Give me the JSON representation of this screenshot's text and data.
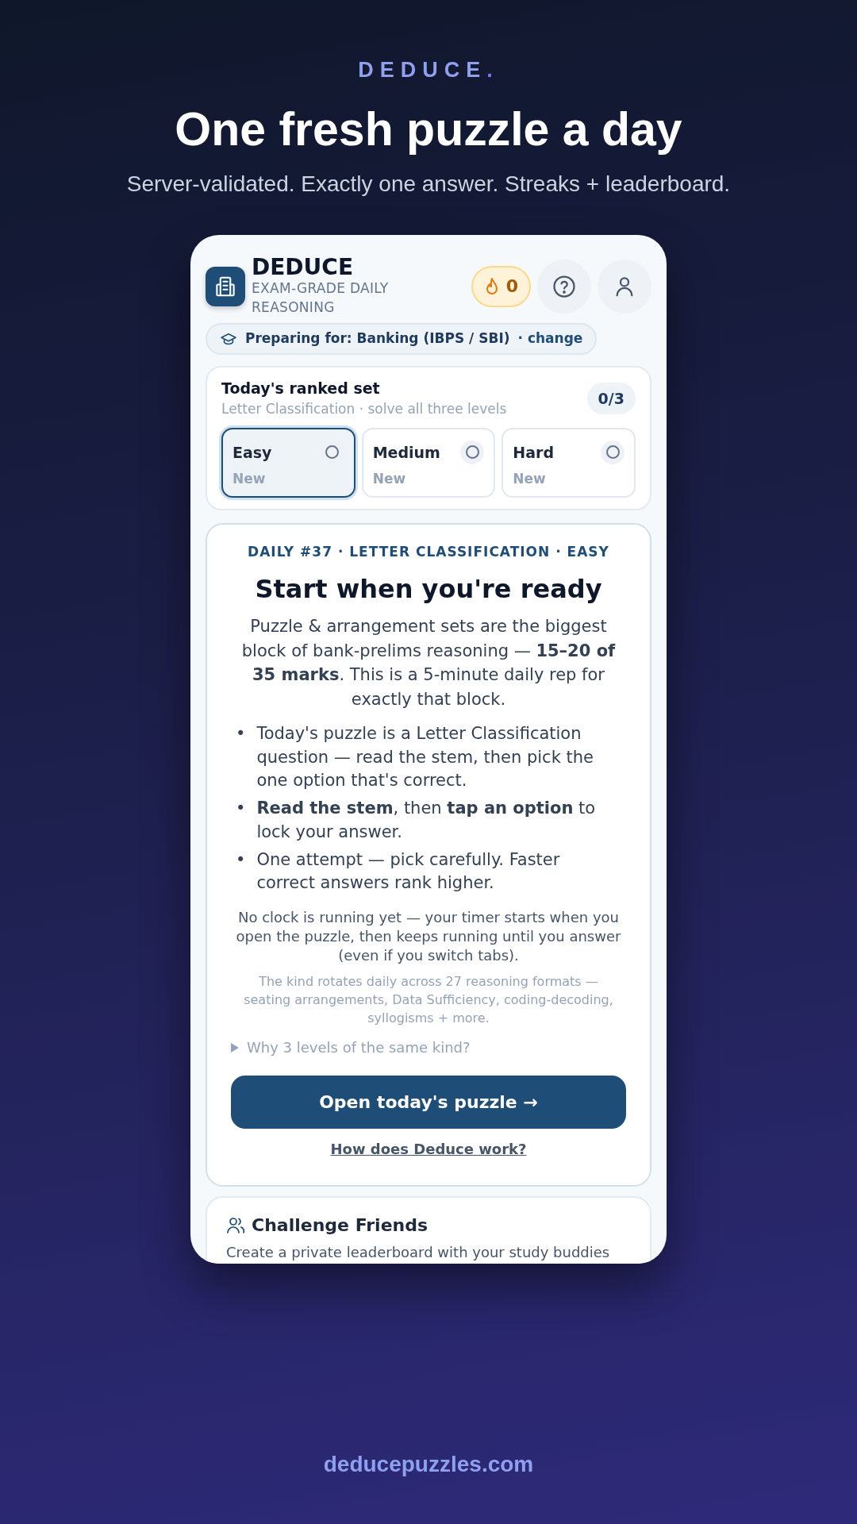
{
  "hero": {
    "brand_name": "DEDUCE",
    "brand_dot": ".",
    "headline": "One fresh puzzle a day",
    "subtitle": "Server-validated. Exactly one answer. Streaks + leaderboard."
  },
  "app": {
    "title": "DEDUCE",
    "tagline": "EXAM-GRADE DAILY REASONING",
    "streak": "0",
    "preparing": {
      "label": "Preparing for: Banking (IBPS / SBI)",
      "link": "· change"
    },
    "ranked_set": {
      "title": "Today's ranked set",
      "subtitle": "Letter Classification · solve all three levels",
      "progress": "0/3",
      "levels": [
        {
          "label": "Easy",
          "status": "New",
          "selected": true,
          "done": false
        },
        {
          "label": "Medium",
          "status": "New",
          "selected": false,
          "done": false
        },
        {
          "label": "Hard",
          "status": "New",
          "selected": false,
          "done": false
        }
      ]
    },
    "daily": {
      "eyebrow": "DAILY #37 · LETTER CLASSIFICATION · EASY",
      "title": "Start when you're ready",
      "intro": "Puzzle & arrangement sets are the biggest block of bank-prelims reasoning — **15–20 of 35 marks**. This is a 5-minute daily rep for exactly that block.",
      "bullets": [
        {
          "marker": "•",
          "text": "Today's puzzle is a Letter Classification question — read the stem, then pick the one option that's correct."
        },
        {
          "marker": "•",
          "text": "**Read the stem**, then **tap an option** to lock your answer."
        },
        {
          "marker": "•",
          "text": "One attempt — pick carefully. Faster correct answers rank higher."
        }
      ],
      "timer_note": "No clock is running yet — your timer starts when you open the puzzle, then keeps running until you answer (even if you switch tabs).",
      "rotation_note": "The kind rotates daily across 27 reasoning formats — seating arrangements, Data Sufficiency, coding-decoding, syllogisms + more.",
      "disclosure": {
        "label": "Why 3 levels of the same kind?",
        "expanded": false
      },
      "button": "Open today's puzzle →",
      "help_link": "How does Deduce work?"
    },
    "challenge": {
      "title": "Challenge Friends",
      "text": "Create a private leaderboard with your study buddies"
    }
  },
  "footer": "deducepuzzles.com"
}
